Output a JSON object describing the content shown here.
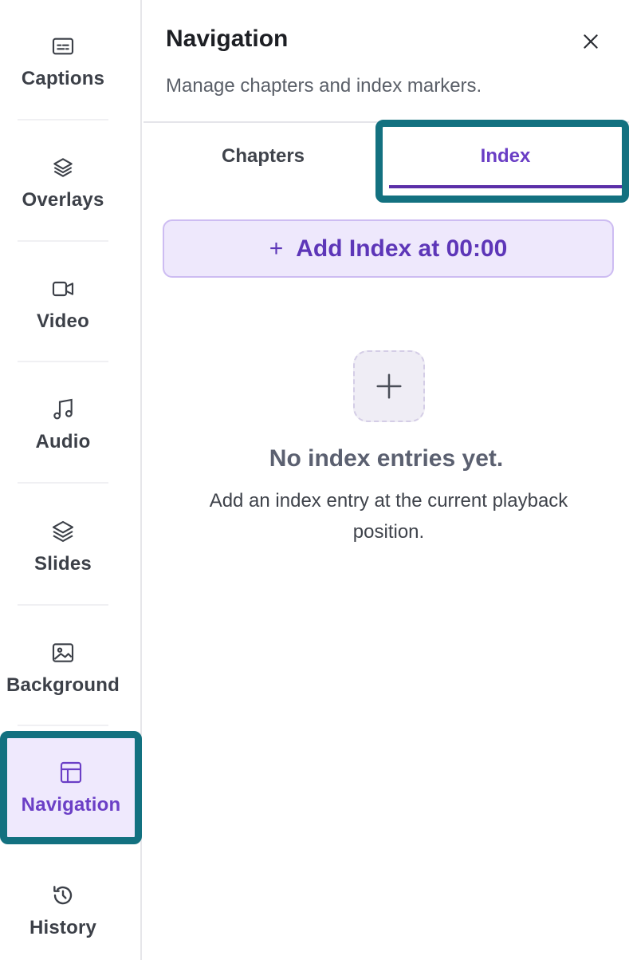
{
  "sidebar": {
    "items": [
      {
        "label": "Captions",
        "icon": "captions-icon"
      },
      {
        "label": "Overlays",
        "icon": "layers-icon"
      },
      {
        "label": "Video",
        "icon": "video-camera-icon"
      },
      {
        "label": "Audio",
        "icon": "music-note-icon"
      },
      {
        "label": "Slides",
        "icon": "slides-stack-icon"
      },
      {
        "label": "Background",
        "icon": "image-icon"
      },
      {
        "label": "Navigation",
        "icon": "layout-icon",
        "active": true
      },
      {
        "label": "History",
        "icon": "history-icon"
      }
    ]
  },
  "panel": {
    "title": "Navigation",
    "subtitle": "Manage chapters and index markers.",
    "close_icon": "close-icon",
    "tabs": [
      {
        "label": "Chapters"
      },
      {
        "label": "Index",
        "active": true
      }
    ],
    "add_button_plus": "+",
    "add_button_label": "Add Index at 00:00",
    "empty_state": {
      "icon": "plus-icon",
      "title": "No index entries yet.",
      "description": "Add an index entry at the current playback position."
    }
  },
  "colors": {
    "accent": "#6b3fc6",
    "highlight_border": "#137180",
    "active_bg": "#efe9fd"
  }
}
